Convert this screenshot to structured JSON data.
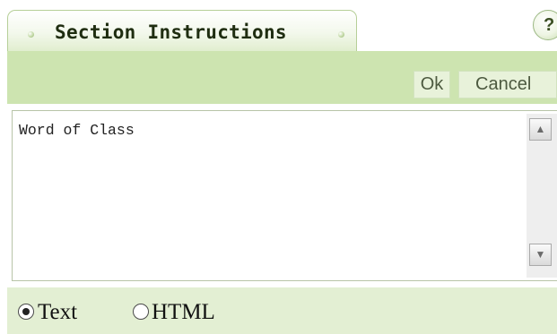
{
  "header": {
    "tab_title": "Section Instructions",
    "help_label": "?"
  },
  "toolbar": {
    "ok_label": "Ok",
    "cancel_label": "Cancel"
  },
  "editor": {
    "value": "Word of Class",
    "scroll_up_glyph": "▲",
    "scroll_down_glyph": "▼"
  },
  "format": {
    "options": [
      {
        "label": "Text",
        "selected": true
      },
      {
        "label": "HTML",
        "selected": false
      }
    ]
  },
  "colors": {
    "accent_green": "#cde4b0",
    "format_bar": "#e3efd3"
  }
}
